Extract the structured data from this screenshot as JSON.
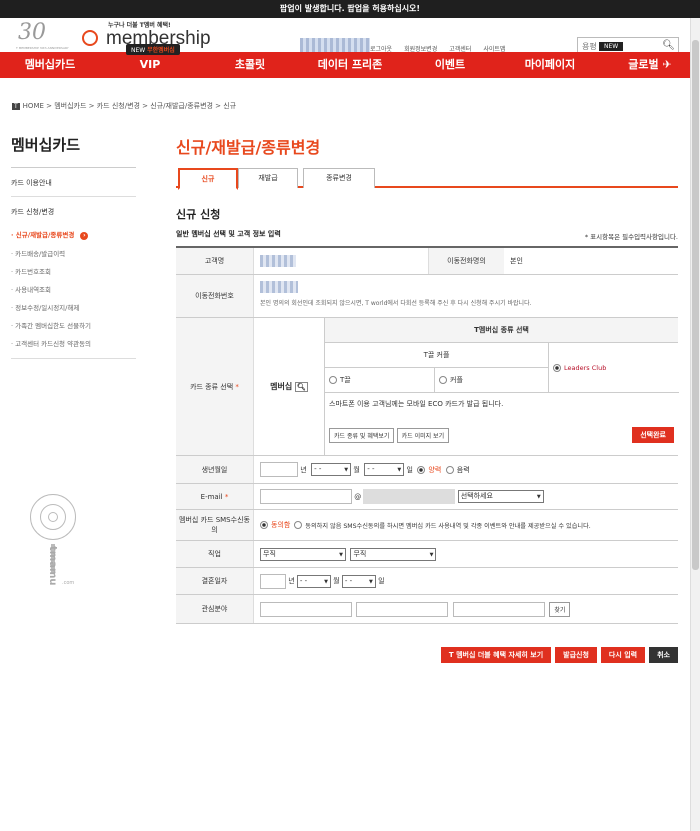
{
  "notice": "팝업이 발생합니다. 팝업을 허용하십시오!",
  "header": {
    "brand_tagline": "누구나 더불 T멤버 혜택!",
    "brand_name": "membership",
    "anniv_number": "30",
    "anniv_sub": "T MEMBERSHIP 30th ANNIVERSARY",
    "new_badge_prefix": "NEW",
    "new_badge_text": "무한멤버십",
    "top_links": [
      "로그아웃",
      "회원정보변경",
      "고객센터",
      "사이트맵"
    ],
    "search_placeholder": "용평 시즌권",
    "global_new": "NEW"
  },
  "gnb": [
    "멤버십카드",
    "VIP",
    "초콜릿",
    "데이터 프리존",
    "이벤트",
    "마이페이지",
    "글로벌"
  ],
  "breadcrumb": {
    "home_badge": "T",
    "path": "HOME > 멤버십카드 > 카드 신청/변경 > 신규/재발급/종류변경 > 신규"
  },
  "lnb": {
    "title": "멤버십카드",
    "menu1": "카드 이용안내",
    "menu2": "카드 신청/변경",
    "items": [
      "· 신규/재발급/종류변경",
      "· 카드배송/발급이력",
      "· 카드번호조회",
      "· 사용내역조회",
      "· 정보수정/일시정지/해제",
      "· 가족간 멤버십한도 선물하기",
      "· 고객센터 카드신청 약관동의"
    ],
    "watermark": "tmamu",
    "watermark_sub": ".com"
  },
  "main": {
    "title": "신규/재발급/종류변경",
    "tabs": [
      "신규",
      "재발급",
      "종류변경"
    ],
    "section_title": "신규 신청",
    "sub_title": "일반 멤버십 선택 및 고객 정보 입력",
    "required_note": "* 표시항목은 필수입력사항입니다.",
    "required_star": "*"
  },
  "form": {
    "customer_label": "고객명",
    "mobile_owner_label": "이동전화명의",
    "mobile_owner_value": "본인",
    "mobile_label": "이동전화번호",
    "mobile_note": "본인 명의의 회선인데 조회되지 않으시면, T world에서 다회선 등록해 주신 후 다시 신청해 주시기 바랍니다.",
    "card_type_label": "카드 종류 선택",
    "membership_label": "멤버십",
    "t_select_title": "T멤버십 종류 선택",
    "t_couple": "T끌 커플",
    "t_option": "T끌",
    "couple_option": "커플",
    "leaders_club": "Leaders Club",
    "eco_note": "스마트폰 이용 고객님께는 모바일 ECO 카드가 발급 됩니다.",
    "btn_card_benefit": "카드 종류 및 혜택보기",
    "btn_card_image": "카드 이미지 보기",
    "btn_select_done": "선택완료",
    "birth_label": "생년월일",
    "year": "년",
    "month": "월",
    "day": "일",
    "dash": "- -",
    "solar": "양력",
    "lunar": "음력",
    "email_label": "E-mail",
    "at": "@",
    "email_select": "선택하세요",
    "sms_label": "멤버십 카드 SMS수신동의",
    "agree": "동의함",
    "disagree_note": "동의하지 않음 SMS수신동의를 하시면 멤버십 카드 사용내역 및 각종 이벤트와 안내를 제공받으실 수 있습니다.",
    "job_label": "직업",
    "job_value1": "무직",
    "job_value2": "무직",
    "wedding_label": "결혼일자",
    "interest_label": "관심분야",
    "find_btn": "찾기"
  },
  "actions": {
    "benefit_detail": "T 멤버십 더블 혜택 자세히 보기",
    "apply": "발급신청",
    "reset": "다시 입력",
    "cancel": "취소"
  }
}
